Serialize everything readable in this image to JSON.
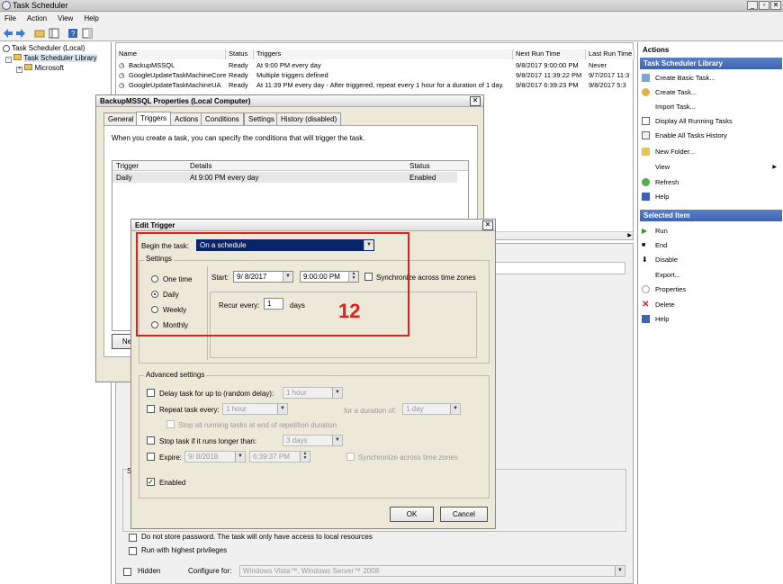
{
  "window": {
    "title": "Task Scheduler"
  },
  "menu": [
    "File",
    "Action",
    "View",
    "Help"
  ],
  "tree": {
    "root": "Task Scheduler (Local)",
    "library": "Task Scheduler Library",
    "child": "Microsoft"
  },
  "tasklist": {
    "headers": [
      "Name",
      "Status",
      "Triggers",
      "Next Run Time",
      "Last Run Time"
    ],
    "rows": [
      {
        "name": "BackupMSSQL",
        "status": "Ready",
        "triggers": "At 9:00 PM every day",
        "next": "9/8/2017 9:00:00 PM",
        "last": "Never"
      },
      {
        "name": "GoogleUpdateTaskMachineCore",
        "status": "Ready",
        "triggers": "Multiple triggers defined",
        "next": "9/8/2017 11:39:22 PM",
        "last": "9/7/2017 11:3"
      },
      {
        "name": "GoogleUpdateTaskMachineUA",
        "status": "Ready",
        "triggers": "At 11:39 PM every day - After triggered, repeat every 1 hour for a duration of 1 day.",
        "next": "9/8/2017 6:39:23 PM",
        "last": "9/8/2017 5:3"
      }
    ]
  },
  "actions": {
    "header": "Actions",
    "section1": "Task Scheduler Library",
    "items1": [
      "Create Basic Task...",
      "Create Task...",
      "Import Task...",
      "Display All Running Tasks",
      "Enable All Tasks History",
      "New Folder...",
      "View",
      "Refresh",
      "Help"
    ],
    "section2": "Selected Item",
    "items2": [
      "Run",
      "End",
      "Disable",
      "Export...",
      "Properties",
      "Delete",
      "Help"
    ]
  },
  "props": {
    "title": "BackupMSSQL Properties (Local Computer)",
    "tabs": [
      "General",
      "Triggers",
      "Actions",
      "Conditions",
      "Settings",
      "History (disabled)"
    ],
    "desc": "When you create a task, you can specify the conditions that will trigger the task.",
    "headers": [
      "Trigger",
      "Details",
      "Status"
    ],
    "row": {
      "trigger": "Daily",
      "details": "At 9:00 PM every day",
      "status": "Enabled"
    },
    "new_btn": "Ne"
  },
  "lower": {
    "no_password": "Do not store password.  The task will only have access to local resources",
    "highest": "Run with highest privileges",
    "hidden": "Hidden",
    "configure_for": "Configure for:",
    "configure_value": "Windows Vista™, Windows Server™ 2008",
    "s_label": "S"
  },
  "edit": {
    "title": "Edit Trigger",
    "begin_label": "Begin the task:",
    "begin_value": "On a schedule",
    "settings_label": "Settings",
    "radios": [
      "One time",
      "Daily",
      "Weekly",
      "Monthly"
    ],
    "selected": "Daily",
    "start_label": "Start:",
    "start_date": "9/  8/2017",
    "start_time": "9:00:00 PM",
    "sync_label": "Synchronize across time zones",
    "recur_label": "Recur every:",
    "recur_value": "1",
    "recur_unit": "days",
    "advanced_label": "Advanced settings",
    "delay_label": "Delay task for up to (random delay):",
    "delay_value": "1 hour",
    "repeat_label": "Repeat task every:",
    "repeat_value": "1 hour",
    "duration_label": "for a duration of:",
    "duration_value": "1 day",
    "stop_running_label": "Stop all running tasks at end of repetition duration",
    "stop_longer_label": "Stop task if it runs longer than:",
    "stop_longer_value": "3 days",
    "expire_label": "Expire:",
    "expire_date": "9/  8/2018",
    "expire_time": "6:39:37 PM",
    "expire_sync": "Synchronize across time zones",
    "enabled_label": "Enabled",
    "ok": "OK",
    "cancel": "Cancel"
  },
  "annotation": "12"
}
